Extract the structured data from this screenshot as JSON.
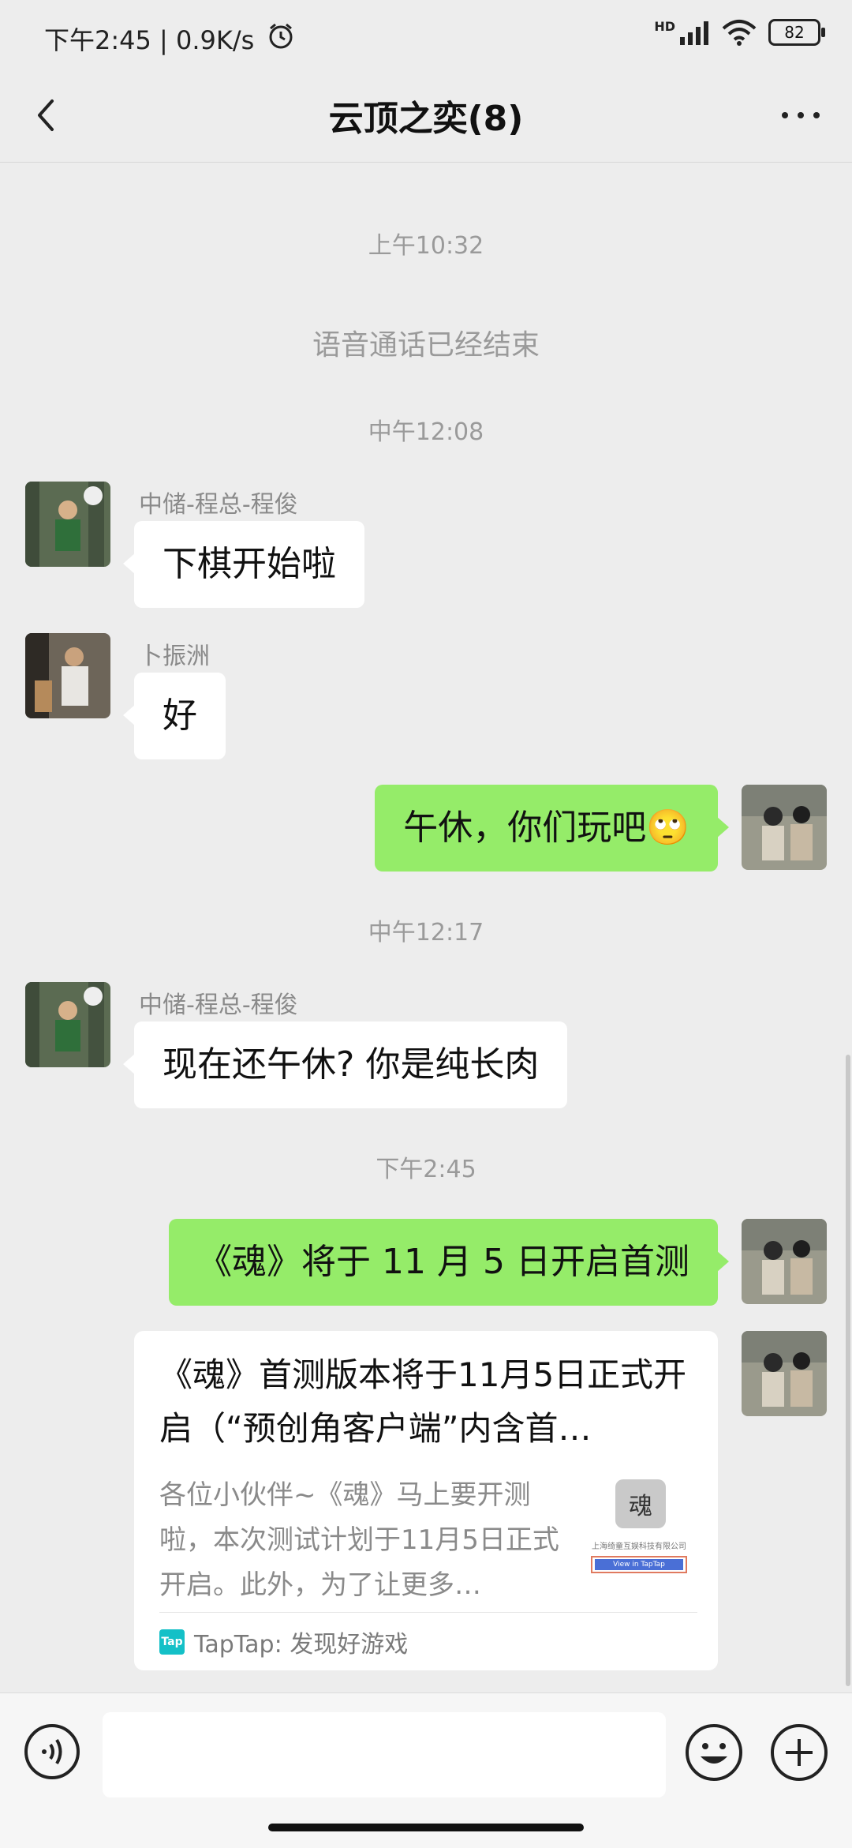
{
  "status": {
    "time": "下午2:45 | 0.9K/s",
    "network": "HD",
    "battery": "82"
  },
  "nav": {
    "title": "云顶之奕(8)"
  },
  "chat": {
    "ts1": "上午10:32",
    "sys1": "语音通话已经结束",
    "ts2": "中午12:08",
    "msg1": {
      "sender": "中储-程总-程俊",
      "text": "下棋开始啦"
    },
    "msg2": {
      "sender": "卜振洲",
      "text": "好"
    },
    "msg3": {
      "text": "午休，你们玩吧🙄"
    },
    "ts3": "中午12:17",
    "msg4": {
      "sender": "中储-程总-程俊",
      "text": "现在还午休? 你是纯长肉"
    },
    "ts4": "下午2:45",
    "msg5": {
      "text": "《魂》将于 11 月 5 日开启首测"
    },
    "card": {
      "title": "《魂》首测版本将于11月5日正式开启（“预创角客户端”内含首…",
      "desc": "各位小伙伴~《魂》马上要开测啦，本次测试计划于11月5日正式开启。此外，为了让更多…",
      "thumb_caption": "上海绮童互娱科技有限公司",
      "thumb_button": "View in TapTap",
      "source": "TapTap: 发现好游戏",
      "source_icon_text": "Tap"
    }
  },
  "colors": {
    "outgoing_bubble": "#95ec69",
    "background": "#ededed",
    "taptap": "#14c0c7"
  }
}
